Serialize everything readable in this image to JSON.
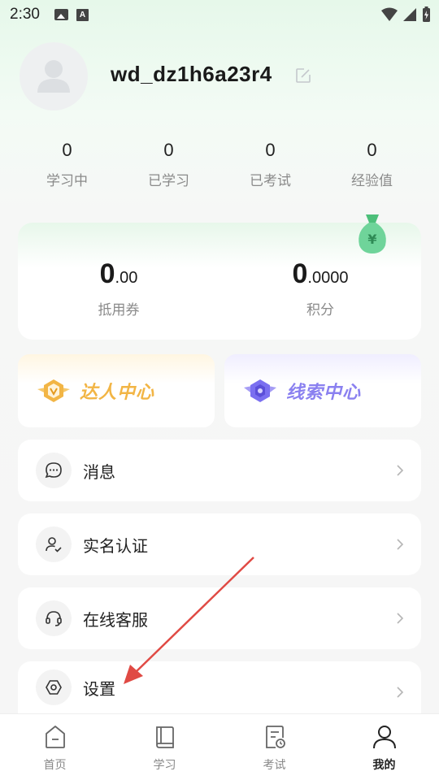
{
  "status_bar": {
    "time": "2:30"
  },
  "profile": {
    "username": "wd_dz1h6a23r4"
  },
  "stats": [
    {
      "value": "0",
      "label": "学习中"
    },
    {
      "value": "0",
      "label": "已学习"
    },
    {
      "value": "0",
      "label": "已考试"
    },
    {
      "value": "0",
      "label": "经验值"
    }
  ],
  "wallet": {
    "voucher": {
      "int": "0",
      "dec": ".00",
      "label": "抵用券"
    },
    "points": {
      "int": "0",
      "dec": ".0000",
      "label": "积分"
    }
  },
  "centers": {
    "talent": {
      "label": "达人中心",
      "color": "#f2b545"
    },
    "clue": {
      "label": "线索中心",
      "color": "#8a80f0"
    }
  },
  "menu": [
    {
      "label": "消息",
      "icon": "chat-bubble-icon"
    },
    {
      "label": "实名认证",
      "icon": "user-verify-icon"
    },
    {
      "label": "在线客服",
      "icon": "headset-icon"
    },
    {
      "label": "设置",
      "icon": "settings-hexagon-icon"
    }
  ],
  "bottom_nav": [
    {
      "label": "首页",
      "icon": "home-icon",
      "active": false
    },
    {
      "label": "学习",
      "icon": "book-icon",
      "active": false
    },
    {
      "label": "考试",
      "icon": "exam-icon",
      "active": false
    },
    {
      "label": "我的",
      "icon": "profile-icon",
      "active": true
    }
  ],
  "colors": {
    "accent_green": "#e6f8ea",
    "annotation_arrow": "#e04a44"
  }
}
